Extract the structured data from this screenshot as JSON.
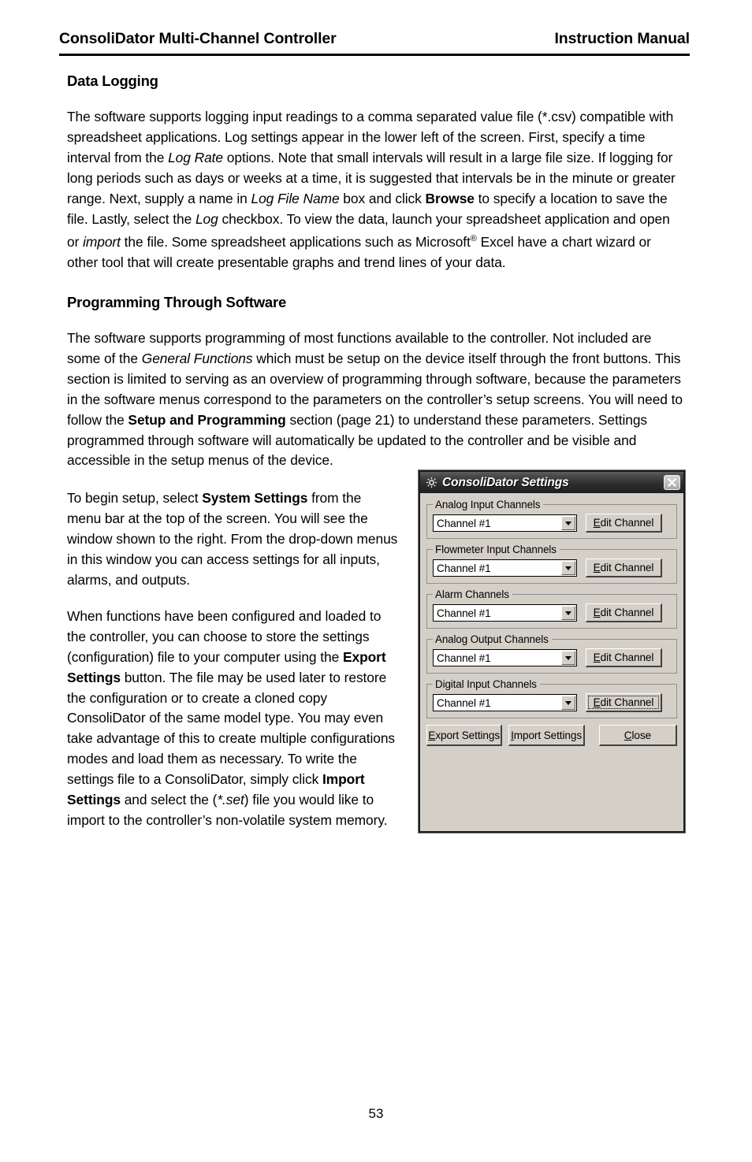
{
  "header": {
    "left_title": "ConsoliDator Multi-Channel Controller",
    "right_title": "Instruction Manual"
  },
  "sections": [
    {
      "heading": "Data Logging",
      "paragraphs": [
        "The software supports logging input readings to a comma separated value file (*.csv) compatible with spreadsheet applications. Log settings appear in the lower left of the screen. First, specify a time interval from the Log Rate options. Note that small intervals will result in a large file size. If logging for long periods such as days or weeks at a time, it is suggested that intervals be in the minute or greater range. Next, supply a name in Log File Name box and click Browse to specify a location to save the file. Lastly, select the Log checkbox. To view the data, launch your spreadsheet application and open or import the file. Some spreadsheet applications such as Microsoft® Excel have a chart wizard or other tool that will create presentable graphs and trend lines of your data."
      ]
    },
    {
      "heading": "Programming Through Software",
      "paragraphs": [
        "The software supports programming of most functions available to the controller. Not included are some of the General Functions which must be setup on the device itself through the front buttons. This section is limited to serving as an overview of programming through software, because the parameters in the software menus correspond to the parameters on the controller’s setup screens. You will need to follow the Setup and Programming section (page 21) to understand these parameters. Settings programmed through software will automatically be updated to the controller and be visible and accessible in the setup menus of the device.",
        "To begin setup, select System Settings from the menu bar at the top of the screen. You will see the window shown to the right. From the drop-down menus in this window you can access settings for all inputs, alarms, and outputs.",
        "When functions have been configured and loaded to the controller, you can choose to store the settings (configuration) file to your computer using the Export Settings button. The file may be used later to restore the configuration or to create a cloned copy ConsoliDator of the same model type. You may even take advantage of this to create multiple configurations modes and load them as necessary. To write the settings file to a ConsoliDator, simply click Import Settings and select the (*.set) file you would like to import to the controller’s non-volatile system memory."
      ]
    }
  ],
  "dialog": {
    "title": "ConsoliDator Settings",
    "title_icon": "sun-gear-icon",
    "close_icon": "close-icon",
    "groups": [
      {
        "legend": "Analog Input Channels",
        "combo_value": "Channel #1",
        "button_accel": "E",
        "button_rest": "dit Channel",
        "focused": false
      },
      {
        "legend": "Flowmeter Input Channels",
        "combo_value": "Channel #1",
        "button_accel": "E",
        "button_rest": "dit Channel",
        "focused": false
      },
      {
        "legend": "Alarm Channels",
        "combo_value": "Channel #1",
        "button_accel": "E",
        "button_rest": "dit Channel",
        "focused": false
      },
      {
        "legend": "Analog Output Channels",
        "combo_value": "Channel #1",
        "button_accel": "E",
        "button_rest": "dit Channel",
        "focused": false
      },
      {
        "legend": "Digital Input Channels",
        "combo_value": "Channel #1",
        "button_accel": "E",
        "button_rest": "dit Channel",
        "focused": true
      }
    ],
    "footer_buttons": [
      {
        "accel": "E",
        "rest": "xport Settings"
      },
      {
        "accel": "I",
        "rest": "mport Settings"
      },
      {
        "accel": "C",
        "rest": "lose"
      }
    ]
  },
  "page_number": "53",
  "colors": {
    "dialog_face": "#d4d0c8",
    "titlebar_dark": "#1f1f1f",
    "text": "#000000",
    "page_background": "#ffffff"
  }
}
